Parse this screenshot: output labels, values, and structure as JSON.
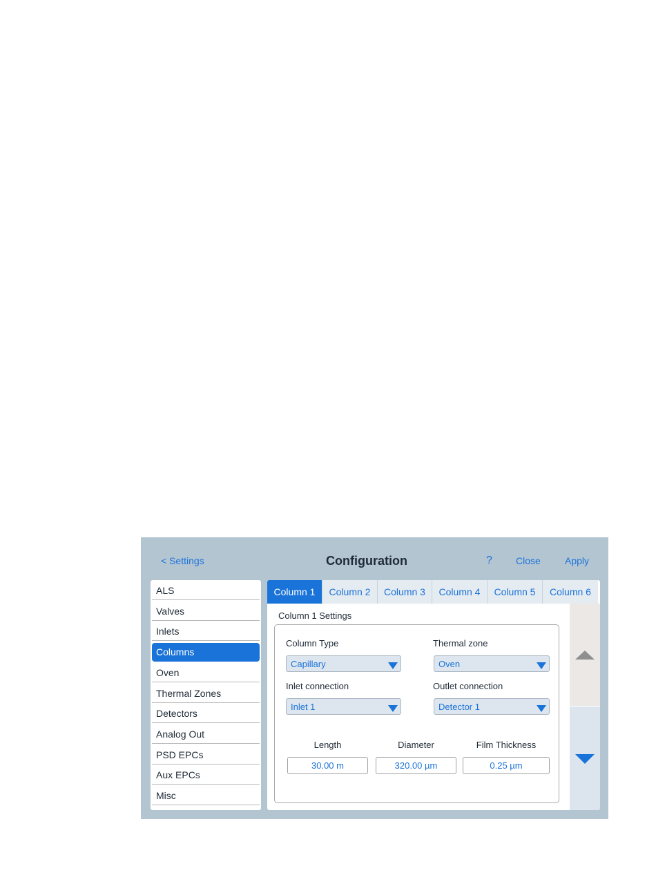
{
  "header": {
    "back_label": "< Settings",
    "title": "Configuration",
    "help_label": "?",
    "close_label": "Close",
    "apply_label": "Apply"
  },
  "sidebar": {
    "items": [
      {
        "label": "ALS"
      },
      {
        "label": "Valves"
      },
      {
        "label": "Inlets"
      },
      {
        "label": "Columns"
      },
      {
        "label": "Oven"
      },
      {
        "label": "Thermal Zones"
      },
      {
        "label": "Detectors"
      },
      {
        "label": "Analog Out"
      },
      {
        "label": "PSD EPCs"
      },
      {
        "label": "Aux EPCs"
      },
      {
        "label": "Misc"
      }
    ],
    "selected": "Columns"
  },
  "tabs": [
    {
      "label": "Column 1"
    },
    {
      "label": "Column 2"
    },
    {
      "label": "Column 3"
    },
    {
      "label": "Column 4"
    },
    {
      "label": "Column 5"
    },
    {
      "label": "Column 6"
    }
  ],
  "section": {
    "title": "Column 1 Settings",
    "column_type": {
      "label": "Column Type",
      "value": "Capillary"
    },
    "thermal_zone": {
      "label": "Thermal zone",
      "value": "Oven"
    },
    "inlet_connection": {
      "label": "Inlet connection",
      "value": "Inlet 1"
    },
    "outlet_connection": {
      "label": "Outlet connection",
      "value": "Detector 1"
    },
    "length": {
      "label": "Length",
      "value": "30.00 m"
    },
    "diameter": {
      "label": "Diameter",
      "value": "320.00 µm"
    },
    "film_thickness": {
      "label": "Film Thickness",
      "value": "0.25 µm"
    }
  },
  "colors": {
    "accent": "#1a73d9",
    "panel_bg": "#b4c5d2",
    "scroll_up_bg": "#ebe8e6",
    "scroll_down_bg": "#dce5ed",
    "arrow_disabled": "#8f8f8f"
  },
  "icons": {
    "scroll_up": "triangle-up-icon",
    "scroll_down": "triangle-down-icon",
    "dropdown": "caret-down-icon"
  }
}
